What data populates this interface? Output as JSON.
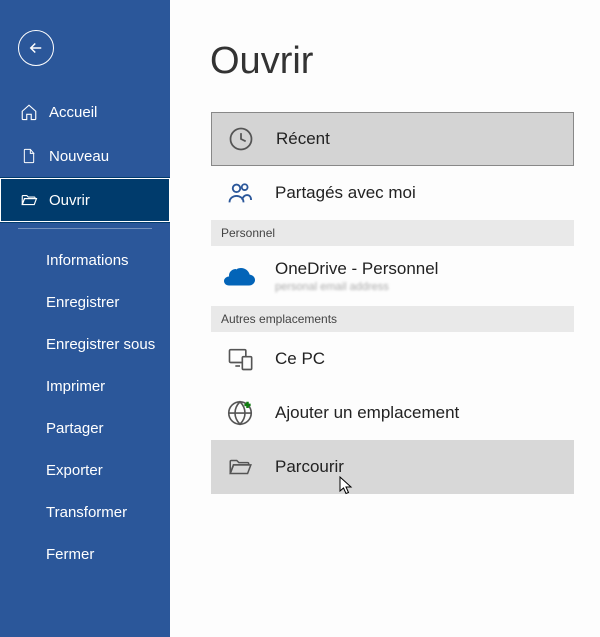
{
  "sidebar": {
    "items": [
      {
        "label": "Accueil"
      },
      {
        "label": "Nouveau"
      },
      {
        "label": "Ouvrir"
      }
    ],
    "subitems": [
      {
        "label": "Informations"
      },
      {
        "label": "Enregistrer"
      },
      {
        "label": "Enregistrer sous"
      },
      {
        "label": "Imprimer"
      },
      {
        "label": "Partager"
      },
      {
        "label": "Exporter"
      },
      {
        "label": "Transformer"
      },
      {
        "label": "Fermer"
      }
    ]
  },
  "main": {
    "title": "Ouvrir",
    "categories": {
      "personal": "Personnel",
      "other": "Autres emplacements"
    },
    "locations": {
      "recent": "Récent",
      "shared": "Partagés avec moi",
      "onedrive": "OneDrive - Personnel",
      "onedrive_sub": "personal email address",
      "thispc": "Ce PC",
      "addplace": "Ajouter un emplacement",
      "browse": "Parcourir"
    }
  }
}
